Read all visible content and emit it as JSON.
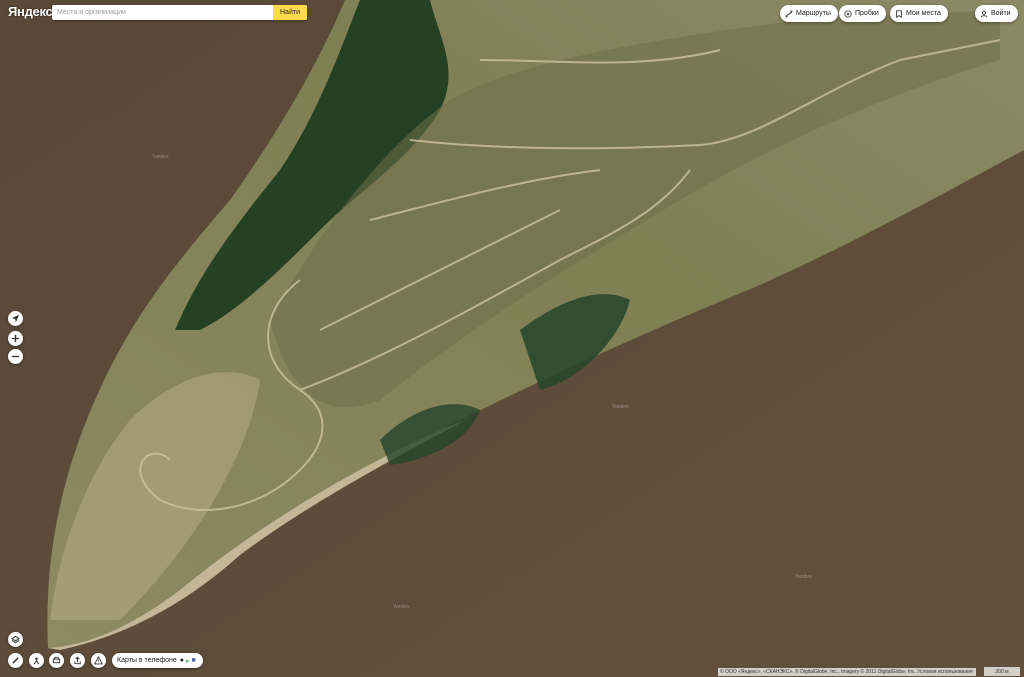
{
  "app": {
    "logo": "Яндекс"
  },
  "search": {
    "placeholder": "Места и организации",
    "button_label": "Найти"
  },
  "top_controls": {
    "routes_label": "Маршруты",
    "traffic_label": "Пробки",
    "my_places_label": "Мои места",
    "login_label": "Войти"
  },
  "bottom_controls": {
    "mobile_label": "Карты в телефоне"
  },
  "attribution": {
    "copyright": "© ООО «Яндекс», «СКАНЭКС», © DigitalGlobe, Inc., Imagery © 2011 DigitalGlobe, Inc. Условия использования",
    "scale": "200 м"
  },
  "map": {
    "watermark": "Yandex",
    "layer": "satellite"
  },
  "icons": {
    "routes": "route-icon",
    "traffic": "traffic-light-icon",
    "my_places": "bookmark-icon",
    "login": "user-icon",
    "locate": "geolocation-arrow-icon",
    "zoom_in": "plus-icon",
    "zoom_out": "minus-icon",
    "layers": "layers-icon",
    "ruler": "ruler-icon",
    "panorama": "panorama-icon",
    "print": "printer-icon",
    "share": "share-icon",
    "feedback": "warning-icon"
  },
  "colors": {
    "river": "#5e4c3a",
    "forest": "#1f3d20",
    "field": "#8a8a5c",
    "sand": "#cfc3a3",
    "search_button": "#ffdb4d"
  }
}
